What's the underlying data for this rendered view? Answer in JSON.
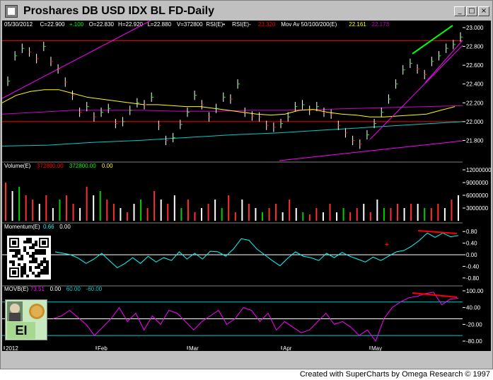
{
  "window": {
    "title": "Proshares DB USD IDX BL FD-Daily",
    "min_glyph": "_",
    "max_glyph": "□",
    "close_glyph": "×"
  },
  "footer": {
    "credit": "Created with SuperCharts by Omega Research © 1997"
  },
  "logo": {
    "text": "EI"
  },
  "colors": {
    "background": "#000000",
    "price": "#ffff00",
    "up": "#00ff00",
    "down": "#ff0000",
    "ma50": "#ffff00",
    "ma100": "#cc00cc",
    "ma200": "#00cccc",
    "trend": "#ff00ff",
    "momentum": "#00ffff",
    "movb": "#ff00ff"
  },
  "price_panel": {
    "header": [
      {
        "text": "05/30/2012",
        "color": "#ffffff"
      },
      {
        "text": "C=22.900",
        "color": "#ffffff"
      },
      {
        "text": "+.100",
        "color": "#00ff00"
      },
      {
        "text": "O=22.830",
        "color": "#ffffff"
      },
      {
        "text": "H=22.920",
        "color": "#ffffff"
      },
      {
        "text": "L=22.880",
        "color": "#ffffff"
      },
      {
        "text": "V=372800",
        "color": "#ffffff"
      },
      {
        "text": "RSI(E)•",
        "color": "#ffffff"
      },
      {
        "text": "RSI(E)-",
        "color": "#ffffff"
      },
      {
        "text": "23.320",
        "color": "#ff0000"
      },
      {
        "text": "Mov Av 50/100/200(E)",
        "color": "#ffffff"
      },
      {
        "text": "22.161",
        "color": "#ffff00"
      },
      {
        "text": "22.173",
        "color": "#cc00cc"
      }
    ],
    "ylim": [
      21.6,
      23.0
    ],
    "ticks": [
      "23.000",
      "22.800",
      "22.600",
      "22.400",
      "22.200",
      "22.000",
      "21.800"
    ],
    "tick_values": [
      23.0,
      22.8,
      22.6,
      22.4,
      22.2,
      22.0,
      21.8
    ],
    "horizontal_levels": [
      22.86,
      22.0
    ]
  },
  "volume_panel": {
    "header": [
      {
        "text": "Volume(E)",
        "color": "#ffffff"
      },
      {
        "text": "372800.00",
        "color": "#ff0000"
      },
      {
        "text": "372800.00",
        "color": "#00ff00"
      },
      {
        "text": "0.00",
        "color": "#ffff00"
      }
    ],
    "ticks": [
      "12000000",
      "9000000",
      "6000000",
      "3000000"
    ],
    "tick_values": [
      12000000,
      9000000,
      6000000,
      3000000
    ]
  },
  "momentum_panel": {
    "header": [
      {
        "text": "Momentum(E)",
        "color": "#ffffff"
      },
      {
        "text": "0.66",
        "color": "#00ffff"
      },
      {
        "text": "0.00",
        "color": "#ffffff"
      }
    ],
    "ticks": [
      "0.80",
      "0.40",
      "0.00",
      "-0.40",
      "-0.80"
    ],
    "tick_values": [
      0.8,
      0.4,
      0.0,
      -0.4,
      -0.8
    ]
  },
  "movb_panel": {
    "header": [
      {
        "text": "MOVB(E)",
        "color": "#ffffff"
      },
      {
        "text": "73.51",
        "color": "#ff00ff"
      },
      {
        "text": "0.00",
        "color": "#ffffff"
      },
      {
        "text": "60.00",
        "color": "#00cccc"
      },
      {
        "text": "-60.00",
        "color": "#00cccc"
      }
    ],
    "ticks": [
      "100.00",
      "40.00",
      "-20.00",
      "-80.00"
    ],
    "tick_values": [
      100,
      40,
      -20,
      -80
    ]
  },
  "x_axis": {
    "labels": [
      "2012",
      "Feb",
      "Mar",
      "Apr",
      "May"
    ]
  },
  "chart_data": {
    "type": "line",
    "title": "Proshares DB USD IDX BL FD-Daily",
    "x_labels": [
      "2012",
      "Feb",
      "Mar",
      "Apr",
      "May"
    ],
    "series": [
      {
        "name": "Close",
        "values": [
          22.43,
          22.7,
          22.78,
          22.74,
          22.67,
          22.8,
          22.64,
          22.56,
          22.42,
          22.28,
          22.1,
          22.16,
          22.05,
          22.1,
          22.14,
          21.98,
          22.0,
          22.12,
          22.2,
          22.18,
          22.26,
          21.96,
          21.8,
          21.83,
          21.97,
          22.1,
          22.28,
          22.18,
          22.05,
          22.14,
          22.26,
          22.24,
          22.4,
          22.1,
          22.06,
          22.05,
          21.96,
          21.94,
          21.98,
          22.05,
          22.16,
          22.18,
          22.12,
          22.16,
          22.1,
          22.08,
          21.96,
          21.88,
          21.8,
          21.76,
          21.86,
          21.98,
          22.1,
          22.24,
          22.4,
          22.55,
          22.62,
          22.56,
          22.5,
          22.64,
          22.7,
          22.78,
          22.82,
          22.9
        ]
      },
      {
        "name": "Mov Av 50",
        "values": [
          22.2,
          22.28,
          22.32,
          22.34,
          22.34,
          22.3,
          22.26,
          22.24,
          22.22,
          22.2,
          22.18,
          22.18,
          22.17,
          22.16,
          22.16,
          22.14,
          22.12,
          22.1,
          22.08,
          22.07,
          22.08,
          22.12,
          22.13,
          22.1,
          22.08,
          22.07,
          22.05,
          22.05,
          22.06,
          22.07,
          22.08,
          22.12,
          22.16
        ]
      },
      {
        "name": "Mov Av 100",
        "values": [
          22.08,
          22.1,
          22.12,
          22.12,
          22.12,
          22.11,
          22.11,
          22.12,
          22.12,
          22.13,
          22.14,
          22.15,
          22.16,
          22.17
        ]
      },
      {
        "name": "Mov Av 200",
        "values": [
          21.74,
          21.75,
          21.78,
          21.8,
          21.83,
          21.86,
          21.88,
          21.91,
          21.94,
          21.97,
          22.0
        ]
      },
      {
        "name": "Momentum",
        "values": [
          0.1,
          0.05,
          0.0,
          -0.12,
          -0.3,
          -0.15,
          0.05,
          -0.2,
          -0.45,
          -0.3,
          -0.1,
          -0.3,
          -0.05,
          -0.25,
          -0.1,
          -0.2,
          0.1,
          -0.15,
          0.05,
          -0.15,
          0.12,
          0.1,
          -0.05,
          0.2,
          0.55,
          0.5,
          0.2,
          0.0,
          -0.2,
          -0.38,
          -0.12,
          0.1,
          -0.05,
          -0.1,
          -0.2,
          0.05,
          -0.1,
          0.08,
          -0.05,
          -0.15,
          -0.25,
          -0.08,
          -0.2,
          -0.05,
          0.1,
          0.15,
          0.3,
          0.5,
          0.75,
          0.6,
          0.75,
          0.62,
          0.66
        ]
      },
      {
        "name": "MOVB",
        "values": [
          0,
          10,
          30,
          5,
          -20,
          -60,
          -30,
          0,
          40,
          -10,
          20,
          -40,
          10,
          -20,
          30,
          20,
          -10,
          -40,
          -10,
          10,
          30,
          -20,
          0,
          40,
          30,
          -10,
          20,
          -40,
          -10,
          -30,
          -50,
          -40,
          -10,
          20,
          -20,
          -10,
          -30,
          -60,
          -40,
          -80,
          0,
          40,
          60,
          75,
          80,
          90,
          95,
          50,
          70,
          73.51
        ]
      }
    ],
    "volume_millions": [
      9,
      7,
      8,
      6,
      5,
      4,
      6,
      3,
      5,
      6,
      4,
      3,
      8,
      6,
      7,
      5,
      4,
      3,
      2,
      4,
      5,
      3,
      7,
      5,
      4,
      6,
      3,
      5,
      2,
      3,
      4,
      5,
      3,
      6,
      2,
      5,
      4,
      3,
      2,
      3,
      4,
      2,
      5,
      3,
      2,
      1.5,
      3,
      2,
      4,
      2,
      3,
      2,
      3,
      4,
      2,
      5,
      3,
      3,
      4,
      3,
      4,
      4,
      3,
      3,
      4,
      3,
      5,
      6
    ]
  }
}
